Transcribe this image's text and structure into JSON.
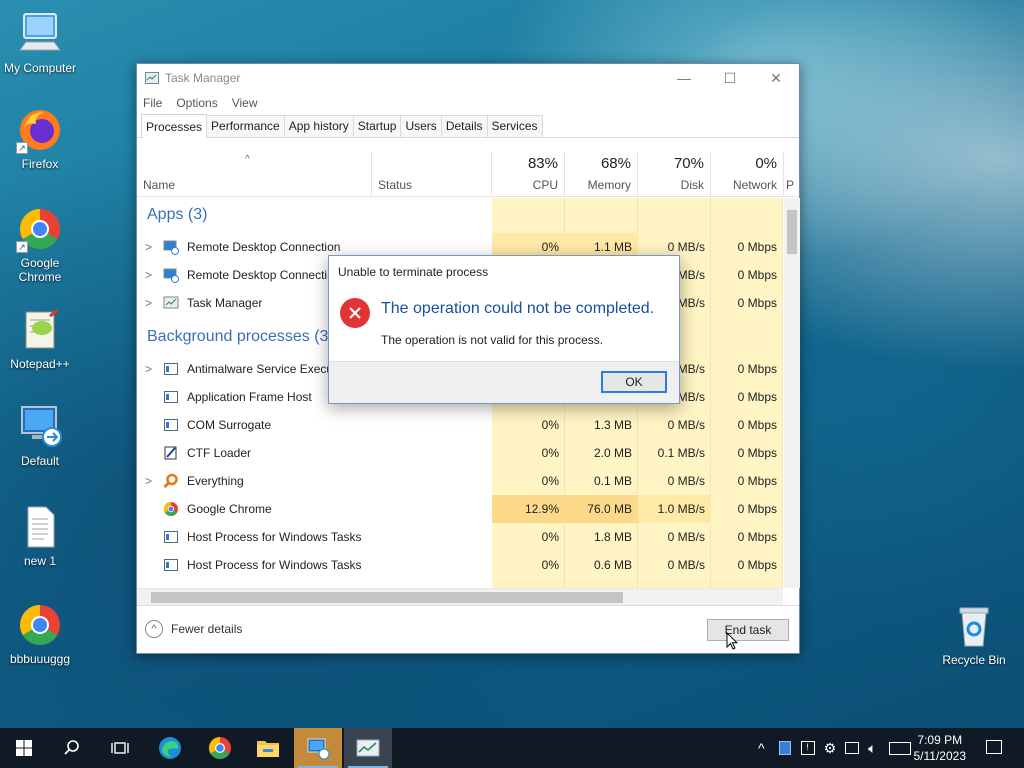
{
  "desktop": {
    "icons": [
      {
        "label": "My Computer",
        "icon": "computer-icon"
      },
      {
        "label": "Firefox",
        "icon": "firefox-icon"
      },
      {
        "label": "Google Chrome",
        "icon": "chrome-icon"
      },
      {
        "label": "Notepad++",
        "icon": "notepadpp-icon"
      },
      {
        "label": "Default",
        "icon": "remote-desktop-icon"
      },
      {
        "label": "new 1",
        "icon": "text-file-icon"
      },
      {
        "label": "bbbuuuggg",
        "icon": "chrome-icon"
      },
      {
        "label": "Recycle Bin",
        "icon": "recycle-bin-icon"
      }
    ]
  },
  "taskmgr": {
    "title": "Task Manager",
    "menu": [
      "File",
      "Options",
      "View"
    ],
    "tabs": [
      "Processes",
      "Performance",
      "App history",
      "Startup",
      "Users",
      "Details",
      "Services"
    ],
    "columns": {
      "name": "Name",
      "status": "Status",
      "cpu": {
        "pct": "83%",
        "label": "CPU"
      },
      "memory": {
        "pct": "68%",
        "label": "Memory"
      },
      "disk": {
        "pct": "70%",
        "label": "Disk"
      },
      "network": {
        "pct": "0%",
        "label": "Network"
      },
      "power_fragment": "P"
    },
    "groups": {
      "apps": "Apps (3)",
      "background": "Background processes (36"
    },
    "rows": [
      {
        "name": "Remote Desktop Connection",
        "cpu": "0%",
        "memory": "1.1 MB",
        "disk": "0 MB/s",
        "network": "0 Mbps"
      },
      {
        "name": "Remote Desktop Connecti",
        "cpu": "",
        "memory": "",
        "disk": "MB/s",
        "network": "0 Mbps"
      },
      {
        "name": "Task Manager",
        "cpu": "",
        "memory": "",
        "disk": "MB/s",
        "network": "0 Mbps"
      },
      {
        "name": "Antimalware Service Execu",
        "cpu": "",
        "memory": "",
        "disk": "MB/s",
        "network": "0 Mbps"
      },
      {
        "name": "Application Frame Host",
        "cpu": "",
        "memory": "",
        "disk": "MB/s",
        "network": "0 Mbps"
      },
      {
        "name": "COM Surrogate",
        "cpu": "0%",
        "memory": "1.3 MB",
        "disk": "0 MB/s",
        "network": "0 Mbps"
      },
      {
        "name": "CTF Loader",
        "cpu": "0%",
        "memory": "2.0 MB",
        "disk": "0.1 MB/s",
        "network": "0 Mbps"
      },
      {
        "name": "Everything",
        "cpu": "0%",
        "memory": "0.1 MB",
        "disk": "0 MB/s",
        "network": "0 Mbps"
      },
      {
        "name": "Google Chrome",
        "cpu": "12.9%",
        "memory": "76.0 MB",
        "disk": "1.0 MB/s",
        "network": "0 Mbps"
      },
      {
        "name": "Host Process for Windows Tasks",
        "cpu": "0%",
        "memory": "1.8 MB",
        "disk": "0 MB/s",
        "network": "0 Mbps"
      },
      {
        "name": "Host Process for Windows Tasks",
        "cpu": "0%",
        "memory": "0.6 MB",
        "disk": "0 MB/s",
        "network": "0 Mbps"
      }
    ],
    "footer": {
      "fewer": "Fewer details",
      "end_task": "End task"
    }
  },
  "dialog": {
    "title": "Unable to terminate process",
    "main": "The operation could not be completed.",
    "sub": "The operation is not valid for this process.",
    "ok": "OK"
  },
  "taskbar": {
    "time": "7:09 PM",
    "date": "5/11/2023"
  }
}
